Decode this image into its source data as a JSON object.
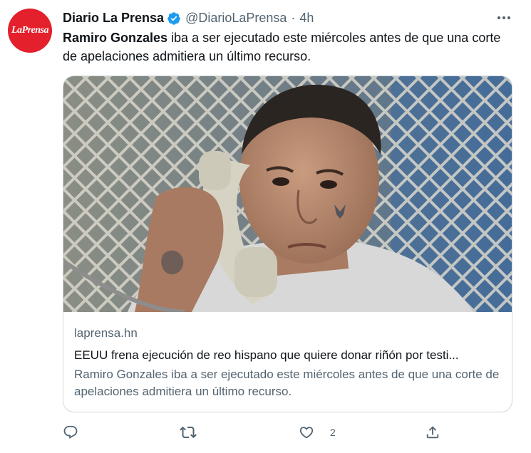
{
  "author": {
    "avatar_text": "LaPrensa",
    "display_name": "Diario La Prensa",
    "handle": "@DiarioLaPrensa",
    "separator": "·",
    "time": "4h",
    "verified": true
  },
  "tweet": {
    "text_bold": "Ramiro Gonzales",
    "text_rest": " iba a ser ejecutado este miércoles antes de que una corte de apelaciones admitiera un último recurso."
  },
  "card": {
    "domain": "laprensa.hn",
    "title": "EEUU frena ejecución de reo hispano que quiere donar riñón por testi...",
    "description": "Ramiro Gonzales iba a ser ejecutado este miércoles antes de que una corte de apelaciones admitiera un último recurso."
  },
  "actions": {
    "reply_icon": "reply-icon",
    "retweet_icon": "retweet-icon",
    "like_icon": "like-icon",
    "like_count": "2",
    "share_icon": "share-icon"
  },
  "colors": {
    "brand_red": "#e3202b",
    "verified_blue": "#1d9bf0",
    "secondary_text": "#536471",
    "primary_text": "#0f1419",
    "border": "#cfd9de"
  }
}
